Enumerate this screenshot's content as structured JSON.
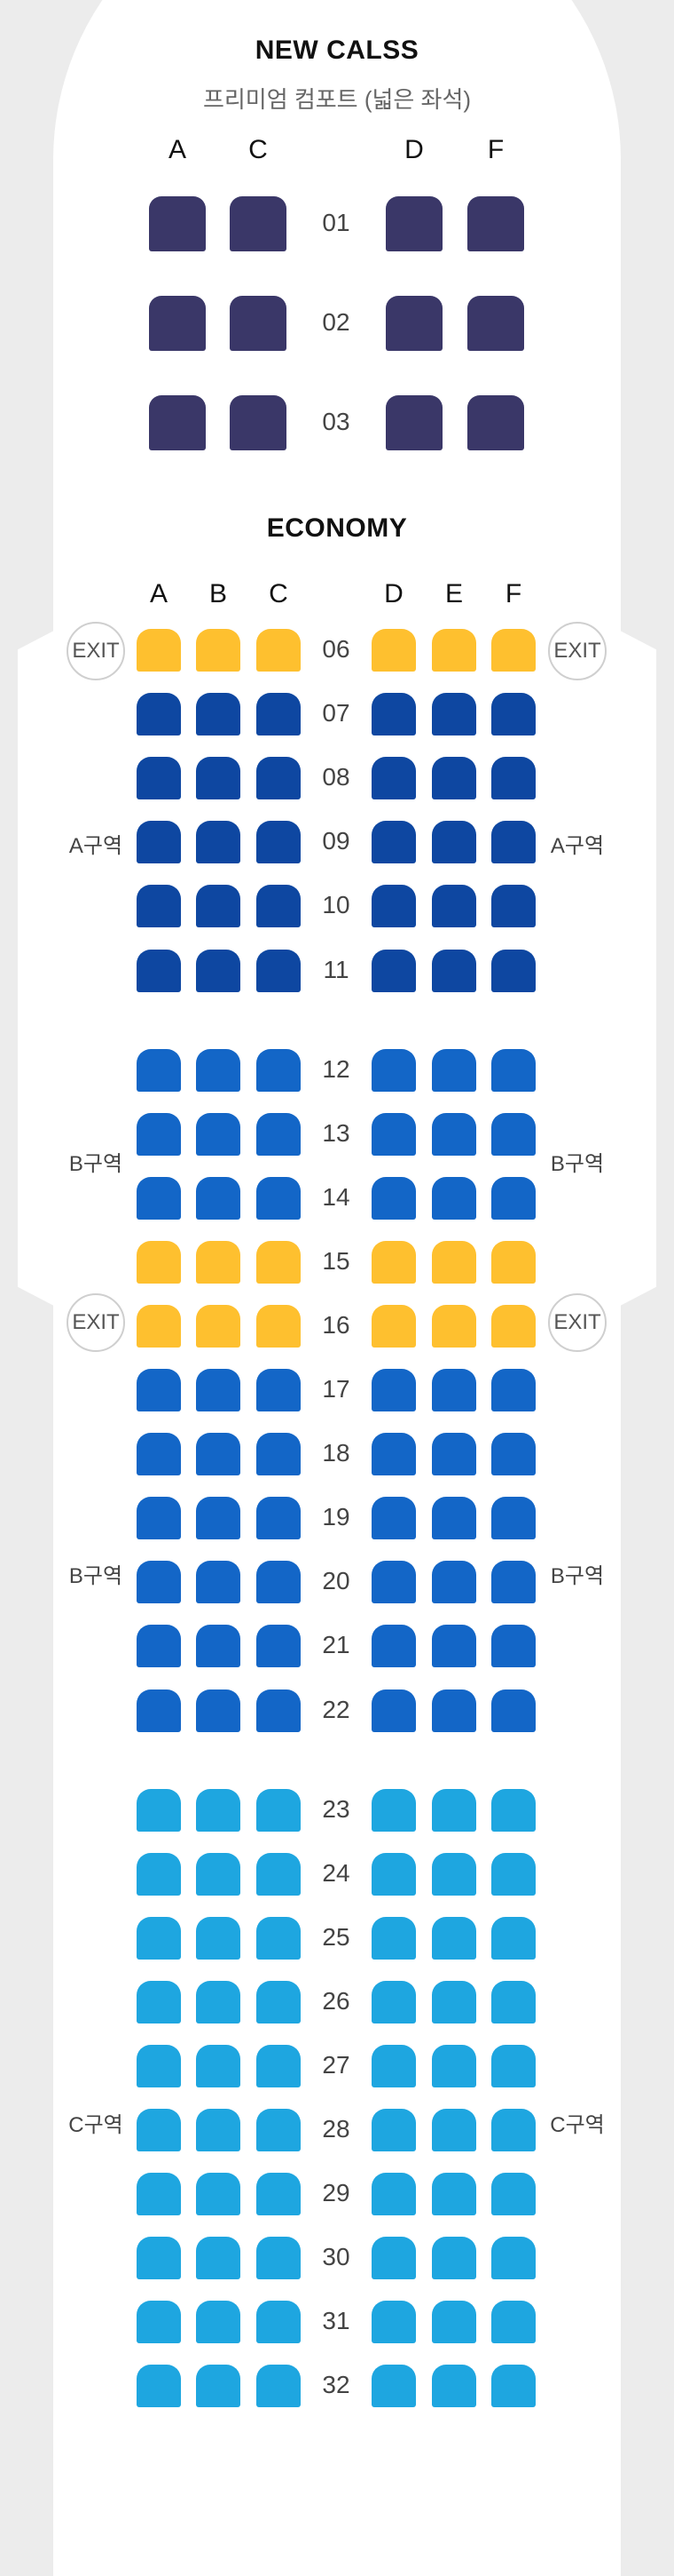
{
  "premium": {
    "title": "NEW CALSS",
    "subtitle": "프리미엄 컴포트 (넓은 좌석)",
    "columns": [
      "A",
      "C",
      "D",
      "F"
    ],
    "rows": [
      "01",
      "02",
      "03"
    ]
  },
  "economy": {
    "title": "ECONOMY",
    "columns": [
      "A",
      "B",
      "C",
      "D",
      "E",
      "F"
    ],
    "rows": [
      {
        "num": "06",
        "zone": "exit"
      },
      {
        "num": "07",
        "zone": "a"
      },
      {
        "num": "08",
        "zone": "a"
      },
      {
        "num": "09",
        "zone": "a"
      },
      {
        "num": "10",
        "zone": "a"
      },
      {
        "num": "11",
        "zone": "a"
      },
      {
        "num": "12",
        "zone": "b"
      },
      {
        "num": "13",
        "zone": "b"
      },
      {
        "num": "14",
        "zone": "b"
      },
      {
        "num": "15",
        "zone": "exit"
      },
      {
        "num": "16",
        "zone": "exit"
      },
      {
        "num": "17",
        "zone": "b"
      },
      {
        "num": "18",
        "zone": "b"
      },
      {
        "num": "19",
        "zone": "b"
      },
      {
        "num": "20",
        "zone": "b"
      },
      {
        "num": "21",
        "zone": "b"
      },
      {
        "num": "22",
        "zone": "b"
      },
      {
        "num": "23",
        "zone": "c"
      },
      {
        "num": "24",
        "zone": "c"
      },
      {
        "num": "25",
        "zone": "c"
      },
      {
        "num": "26",
        "zone": "c"
      },
      {
        "num": "27",
        "zone": "c"
      },
      {
        "num": "28",
        "zone": "c"
      },
      {
        "num": "29",
        "zone": "c"
      },
      {
        "num": "30",
        "zone": "c"
      },
      {
        "num": "31",
        "zone": "c"
      },
      {
        "num": "32",
        "zone": "c"
      }
    ]
  },
  "exit_label": "EXIT",
  "zone_labels": {
    "a": "A구역",
    "b": "B구역",
    "c": "C구역"
  },
  "colors": {
    "premium_seat": "#3a3768",
    "exit_row_seat": "#fec02f",
    "zone_a_seat": "#0e47a1",
    "zone_b_seat": "#1366c7",
    "zone_c_seat": "#1ea6e0"
  }
}
